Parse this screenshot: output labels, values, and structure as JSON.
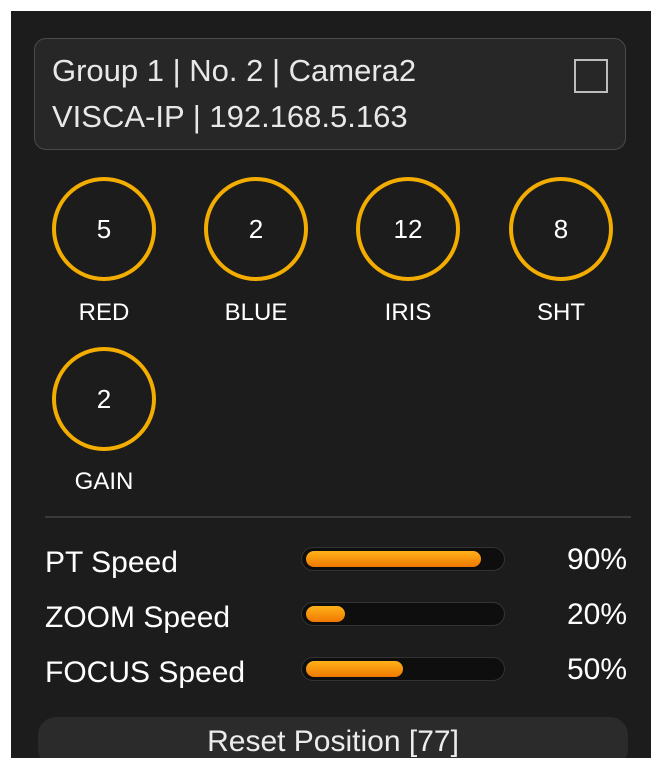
{
  "camera": {
    "line1": "Group 1 | No. 2 | Camera2",
    "line2": "VISCA-IP | 192.168.5.163",
    "selected": false
  },
  "knobs": [
    {
      "value": "5",
      "label": "RED"
    },
    {
      "value": "2",
      "label": "BLUE"
    },
    {
      "value": "12",
      "label": "IRIS"
    },
    {
      "value": "8",
      "label": "SHT"
    },
    {
      "value": "2",
      "label": "GAIN"
    }
  ],
  "speeds": [
    {
      "label": "PT Speed",
      "percent_text": "90%",
      "fraction": 0.9
    },
    {
      "label": "ZOOM Speed",
      "percent_text": "20%",
      "fraction": 0.2
    },
    {
      "label": "FOCUS Speed",
      "percent_text": "50%",
      "fraction": 0.5
    }
  ],
  "reset_button": {
    "label": "Reset Position [77]"
  },
  "colors": {
    "accent": "#f3ac00",
    "panel_bg": "#1c1c1c",
    "fill_top": "#ffb21a",
    "fill_bottom": "#f07800"
  }
}
